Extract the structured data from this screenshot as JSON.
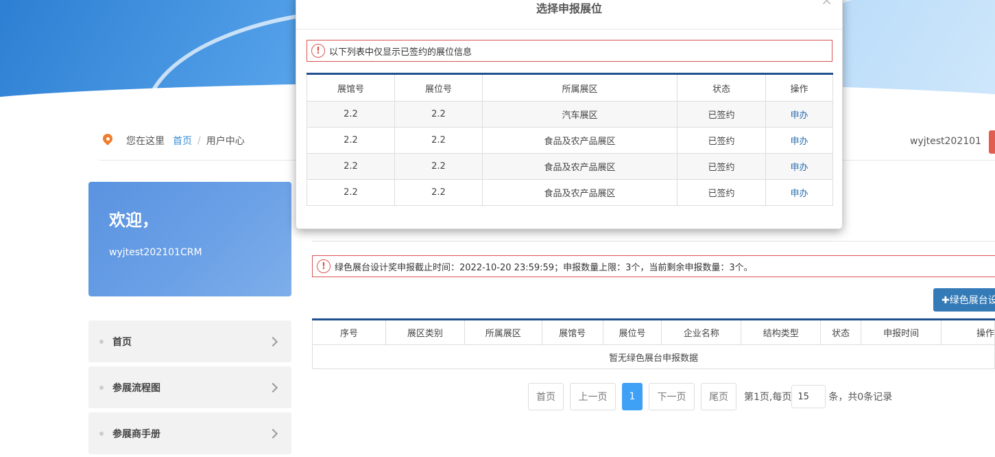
{
  "breadcrumb": {
    "prefix": "您在这里",
    "home": "首页",
    "separator": "/",
    "current": "用户中心"
  },
  "user": {
    "name": "wyjtest202101"
  },
  "welcome": {
    "greeting": "欢迎，",
    "account": "wyjtest202101CRM"
  },
  "sidebar": {
    "items": [
      {
        "label": "首页"
      },
      {
        "label": "参展流程图"
      },
      {
        "label": "参展商手册"
      }
    ]
  },
  "main": {
    "notice": "绿色展台设计奖申报截止时间：2022-10-20 23:59:59；申报数量上限：3个，当前剩余申报数量：3个。",
    "add_button": "✚绿色展台设",
    "table": {
      "columns": [
        "序号",
        "展区类别",
        "所属展区",
        "展馆号",
        "展位号",
        "企业名称",
        "结构类型",
        "状态",
        "申报时间",
        "操作"
      ],
      "empty_text": "暂无绿色展台申报数据"
    },
    "pager": {
      "first": "首页",
      "prev": "上一页",
      "current": "1",
      "next": "下一页",
      "last": "尾页",
      "page_info": "第1页,每页",
      "page_size": "15",
      "suffix": "条，共0条记录"
    }
  },
  "modal": {
    "title": "选择申报展位",
    "close": "×",
    "notice": "以下列表中仅显示已签约的展位信息",
    "columns": [
      "展馆号",
      "展位号",
      "所属展区",
      "状态",
      "操作"
    ],
    "rows": [
      {
        "hall": "2.2",
        "booth": "2.2",
        "zone": "汽车展区",
        "status": "已签约",
        "action": "申办"
      },
      {
        "hall": "2.2",
        "booth": "2.2",
        "zone": "食品及农产品展区",
        "status": "已签约",
        "action": "申办"
      },
      {
        "hall": "2.2",
        "booth": "2.2",
        "zone": "食品及农产品展区",
        "status": "已签约",
        "action": "申办"
      },
      {
        "hall": "2.2",
        "booth": "2.2",
        "zone": "食品及农产品展区",
        "status": "已签约",
        "action": "申办"
      }
    ]
  },
  "colors": {
    "accent": "#337ab7",
    "header_border": "#1f4f8f",
    "alert": "#d9534f",
    "active_page": "#3ea1f5"
  }
}
